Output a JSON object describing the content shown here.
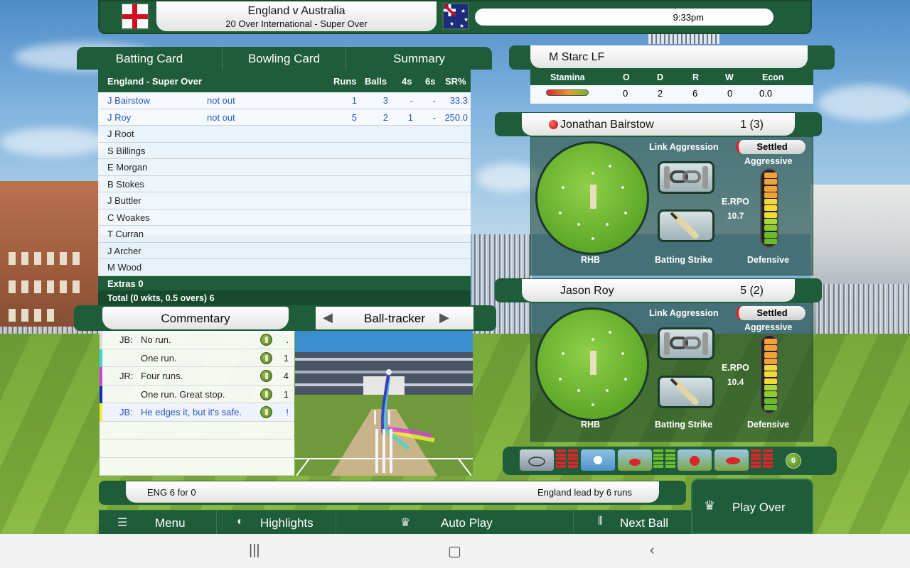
{
  "header": {
    "match_title": "England v Australia",
    "match_subtitle": "20 Over International - Super Over",
    "time": "9:33pm",
    "home_flag": "england-flag-icon",
    "away_flag": "australia-flag-icon"
  },
  "scorecard": {
    "tabs": [
      "Batting Card",
      "Bowling Card",
      "Summary"
    ],
    "heading": "England - Super Over",
    "columns": [
      "Runs",
      "Balls",
      "4s",
      "6s",
      "SR%"
    ],
    "batters": [
      {
        "name": "J Bairstow",
        "status": "not out",
        "runs": "1",
        "balls": "3",
        "fours": "-",
        "sixes": "-",
        "sr": "33.3"
      },
      {
        "name": "J Roy",
        "status": "not out",
        "runs": "5",
        "balls": "2",
        "fours": "1",
        "sixes": "-",
        "sr": "250.0"
      },
      {
        "name": "J Root"
      },
      {
        "name": "S Billings"
      },
      {
        "name": "E Morgan"
      },
      {
        "name": "B Stokes"
      },
      {
        "name": "J Buttler"
      },
      {
        "name": "C Woakes"
      },
      {
        "name": "T Curran"
      },
      {
        "name": "J Archer"
      },
      {
        "name": "M Wood"
      }
    ],
    "extras": "Extras  0",
    "total": "Total (0 wkts, 0.5 overs) 6"
  },
  "commentary": {
    "title": "Commentary",
    "tracker_title": "Ball-tracker",
    "entries": [
      {
        "who": "JB:",
        "text": "No run.",
        "result": ".",
        "color": "#dddddd"
      },
      {
        "who": "",
        "text": "One run.",
        "result": "1",
        "color": "#3fd6d6"
      },
      {
        "who": "JR:",
        "text": "Four runs.",
        "result": "4",
        "color": "#d63fd6"
      },
      {
        "who": "",
        "text": "One run. Great stop.",
        "result": "1",
        "color": "#1a2ab8"
      },
      {
        "who": "JB:",
        "text": "He edges it, but it's safe.",
        "result": "!",
        "color": "#f2ef3a"
      }
    ]
  },
  "bowler": {
    "name": "M Starc LF",
    "columns": [
      "Stamina",
      "O",
      "D",
      "R",
      "W",
      "Econ"
    ],
    "stamina": 0.8,
    "overs": "0",
    "dots": "2",
    "runs": "6",
    "wickets": "0",
    "econ": "0.0"
  },
  "batter1": {
    "name": "Jonathan Bairstow",
    "score": "1 (3)",
    "stance": "RHB",
    "link_label": "Link Aggression",
    "state": "Settled",
    "aggressive": "Aggressive",
    "defensive": "Defensive",
    "erpo_label": "E.RPO",
    "erpo_value": "10.7",
    "strike_label": "Batting Strike"
  },
  "batter2": {
    "name": "Jason Roy",
    "score": "5 (2)",
    "stance": "RHB",
    "link_label": "Link Aggression",
    "state": "Settled",
    "aggressive": "Aggressive",
    "defensive": "Defensive",
    "erpo_label": "E.RPO",
    "erpo_value": "10.4",
    "strike_label": "Batting Strike"
  },
  "conditions": {
    "six_badge": "6"
  },
  "score_line": {
    "left": "ENG  6 for 0",
    "right": "England lead by 6 runs"
  },
  "menu": {
    "menu": "Menu",
    "highlights": "Highlights",
    "auto_play": "Auto Play",
    "next_ball": "Next Ball",
    "play_over": "Play Over"
  },
  "colors": {
    "panel_green": "#1f5c3a",
    "active_text": "#2a58c2"
  }
}
